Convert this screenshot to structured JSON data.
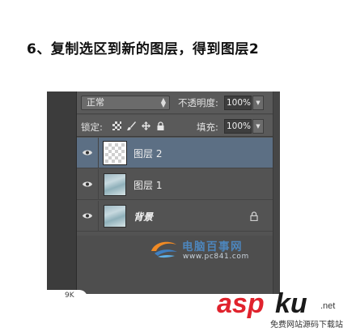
{
  "heading": "6、复制选区到新的图层，得到图层2",
  "panel": {
    "blend_mode": "正常",
    "opacity_label": "不透明度:",
    "opacity_value": "100%",
    "lock_label": "锁定:",
    "fill_label": "填充:",
    "fill_value": "100%",
    "icons": {
      "updown": "up-down-arrows-icon",
      "dropdown": "chevron-down-icon",
      "lock_transparent": "lock-transparent-pixels-icon",
      "lock_paint": "lock-image-pixels-icon",
      "lock_move": "lock-position-icon",
      "lock_all": "lock-all-icon",
      "visibility": "eye-icon",
      "layer_lock": "lock-icon"
    },
    "layers": [
      {
        "name": "图层 2",
        "selected": true,
        "visible": true,
        "thumbnail": "transparent"
      },
      {
        "name": "图层 1",
        "selected": false,
        "visible": true,
        "thumbnail": "photo"
      },
      {
        "name": "背景",
        "selected": false,
        "visible": true,
        "thumbnail": "photo",
        "locked": true
      }
    ]
  },
  "cut_text": "9K",
  "watermark1": {
    "cn": "电脑百事网",
    "url": "www.pc841.com"
  },
  "watermark2": {
    "asp": "asp",
    "ku": "ku",
    "net": ".net",
    "sub": "免费网站源码下载站"
  },
  "colors": {
    "selected_layer": "#5c6f84",
    "panel_bg": "#535353",
    "asp_red": "#e0232d"
  }
}
